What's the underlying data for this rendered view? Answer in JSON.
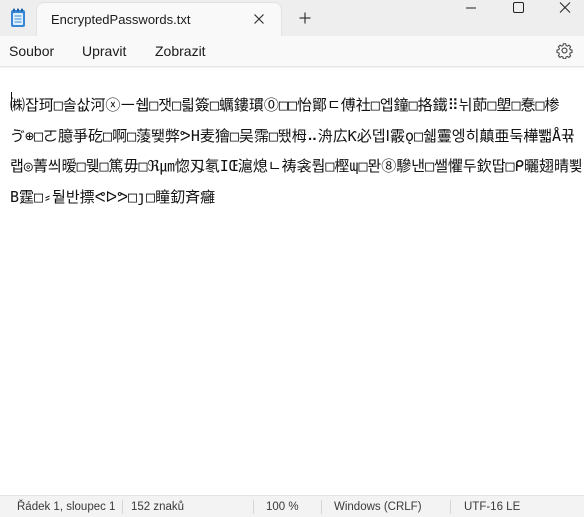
{
  "window": {
    "tab_title": "EncryptedPasswords.txt",
    "minimize_glyph": "—",
    "maximize_glyph": "☐",
    "close_glyph": "✕"
  },
  "menu": {
    "file": "Soubor",
    "edit": "Upravit",
    "view": "Zobrazit"
  },
  "editor": {
    "lines": [
      "㈱잡珂□솔삾河ⓧ㇐쉡□잿□릛簽□蠣鏤瑻⓪□□怡鄮ㄷ傅社□엡鐘□挌鐵⠿뉘莭□塱□惷□椮",
      "ゔ⊕□ㄛ臆爭矻□啊□蔆뙟弊ᕗH麦獪□吴霈□뙜栂⠤洀広Ƙ必뎁Ⅰ霰ǫ□쉛霻엥히㒹亜둑樺뾃Å뀪",
      "랩◎菁씌暧□뮂□篤毋□ℜ㎛惚刄氡IŒ滬熄ㄴ祷衾뤕□樫պ□뫈⑧驂낸□쌜懼두欽땁□ᑭ曬翅晴뾫",
      "B霆□⸗뒅반摽ᕙᐅᕗ□ȷ□瞳釖斉癰"
    ]
  },
  "status": {
    "position": "Řádek 1, sloupec 1",
    "chars": "152 znaků",
    "zoom": "100 %",
    "line_ending": "Windows (CRLF)",
    "encoding": "UTF-16 LE"
  }
}
